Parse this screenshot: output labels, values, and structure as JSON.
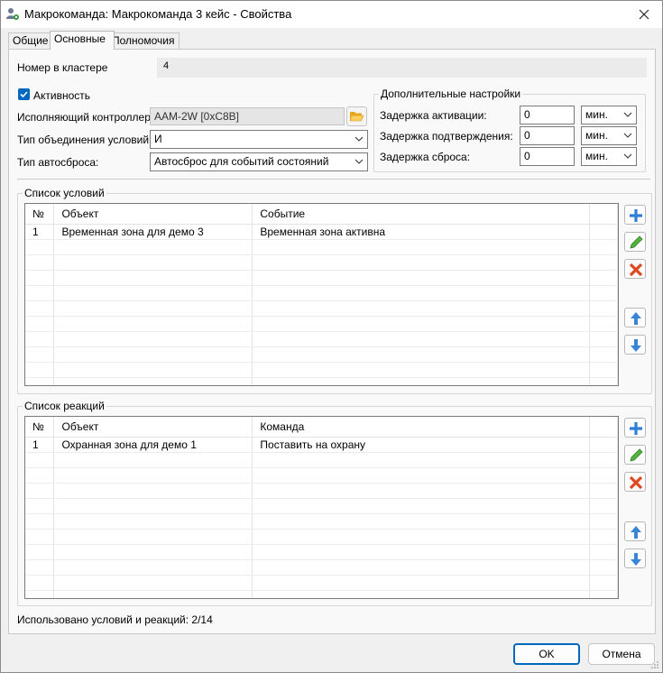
{
  "window": {
    "title": "Макрокоманда: Макрокоманда 3 кейс  - Свойства"
  },
  "tabs": [
    {
      "label": "Общие"
    },
    {
      "label": "Основные"
    },
    {
      "label": "Полномочия"
    }
  ],
  "form": {
    "cluster_number_label": "Номер в кластере",
    "cluster_number_value": "4",
    "activity_label": "Активность",
    "activity_checked": true,
    "controller_label": "Исполняющий контроллер:",
    "controller_value": "AAM-2W [0xC8B]",
    "condition_type_label": "Тип объединения условий:",
    "condition_type_value": "И",
    "autoreset_label": "Тип автосброса:",
    "autoreset_value": "Автосброс для событий состояний"
  },
  "extra": {
    "title": "Дополнительные настройки",
    "rows": [
      {
        "label": "Задержка активации:",
        "value": "0",
        "unit": "мин."
      },
      {
        "label": "Задержка подтверждения:",
        "value": "0",
        "unit": "мин."
      },
      {
        "label": "Задержка сброса:",
        "value": "0",
        "unit": "мин."
      }
    ]
  },
  "conditions": {
    "title": "Список условий",
    "columns": {
      "num": "№",
      "object": "Объект",
      "event": "Событие"
    },
    "rows": [
      {
        "num": "1",
        "object": "Временная зона для демо 3",
        "event": "Временная зона активна"
      }
    ]
  },
  "reactions": {
    "title": "Список реакций",
    "columns": {
      "num": "№",
      "object": "Объект",
      "command": "Команда"
    },
    "rows": [
      {
        "num": "1",
        "object": "Охранная зона для демо 1",
        "command": "Поставить на охрану"
      }
    ]
  },
  "footer": {
    "usage_text": "Использовано условий и реакций: 2/14",
    "ok_label": "OK",
    "cancel_label": "Отмена"
  },
  "colors": {
    "accent": "#0067c0",
    "add_icon": "#2f7fd6",
    "edit_icon": "#3f9d32",
    "delete_icon": "#e0491f",
    "arrow_icon": "#3a85d8",
    "folder_icon": "#f2b632"
  }
}
